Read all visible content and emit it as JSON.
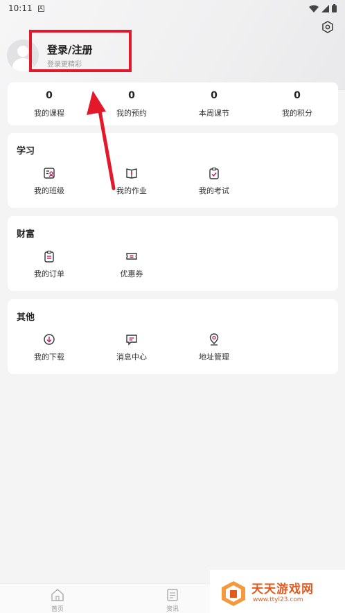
{
  "status_bar": {
    "time": "10:11"
  },
  "profile": {
    "title": "登录/注册",
    "subtitle": "登录更精彩"
  },
  "stats": [
    {
      "value": "0",
      "label": "我的课程"
    },
    {
      "value": "0",
      "label": "我的预约"
    },
    {
      "value": "0",
      "label": "本周课节"
    },
    {
      "value": "0",
      "label": "我的积分"
    }
  ],
  "sections": {
    "study": {
      "title": "学习",
      "items": [
        {
          "label": "我的班级",
          "icon": "class-icon"
        },
        {
          "label": "我的作业",
          "icon": "homework-icon"
        },
        {
          "label": "我的考试",
          "icon": "exam-icon"
        }
      ]
    },
    "wealth": {
      "title": "财富",
      "items": [
        {
          "label": "我的订单",
          "icon": "order-icon"
        },
        {
          "label": "优惠券",
          "icon": "coupon-icon"
        }
      ]
    },
    "other": {
      "title": "其他",
      "items": [
        {
          "label": "我的下载",
          "icon": "download-icon"
        },
        {
          "label": "消息中心",
          "icon": "message-icon"
        },
        {
          "label": "地址管理",
          "icon": "location-icon"
        }
      ]
    }
  },
  "tabbar": [
    {
      "label": "首页",
      "icon": "home-icon"
    },
    {
      "label": "资讯",
      "icon": "news-icon"
    }
  ],
  "watermark": {
    "title": "天天游戏网",
    "url": "www.ttyl23.com"
  },
  "colors": {
    "accent": "#c2185b",
    "annotation": "#e3192b",
    "watermark": "#e15a1f"
  }
}
